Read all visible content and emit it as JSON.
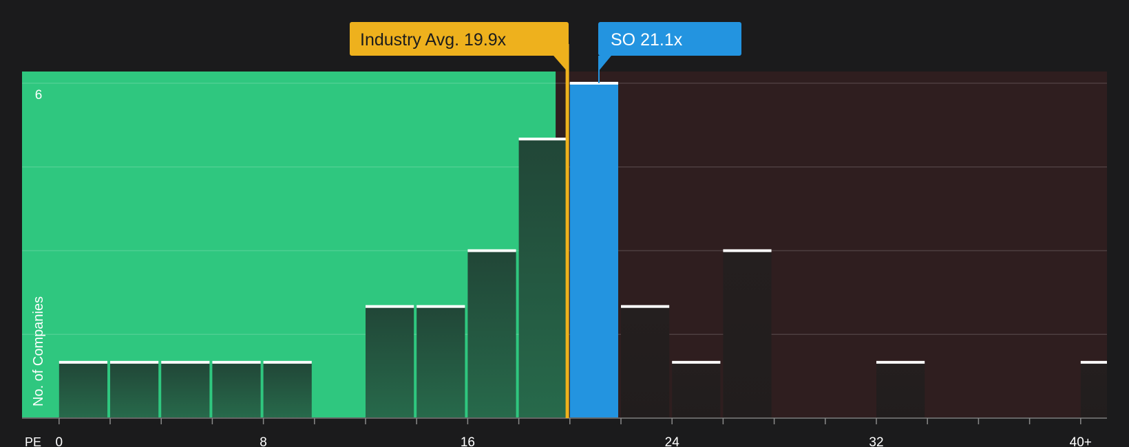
{
  "chart_data": {
    "type": "bar",
    "xlabel": "PE",
    "ylabel": "No. of Companies",
    "bin_width": 2,
    "bins": [
      {
        "x": 0,
        "count": 1
      },
      {
        "x": 2,
        "count": 1
      },
      {
        "x": 4,
        "count": 1
      },
      {
        "x": 6,
        "count": 1
      },
      {
        "x": 8,
        "count": 1
      },
      {
        "x": 10,
        "count": 0
      },
      {
        "x": 12,
        "count": 2
      },
      {
        "x": 14,
        "count": 2
      },
      {
        "x": 16,
        "count": 3
      },
      {
        "x": 18,
        "count": 5
      },
      {
        "x": 20,
        "count": 6
      },
      {
        "x": 22,
        "count": 2
      },
      {
        "x": 24,
        "count": 1
      },
      {
        "x": 26,
        "count": 3
      },
      {
        "x": 28,
        "count": 0
      },
      {
        "x": 30,
        "count": 0
      },
      {
        "x": 32,
        "count": 1
      },
      {
        "x": 34,
        "count": 0
      },
      {
        "x": 36,
        "count": 0
      },
      {
        "x": 38,
        "count": 0
      },
      {
        "x": 40,
        "count": 1
      }
    ],
    "highlight_bin_x": 20,
    "x_ticks": [
      {
        "value": 0,
        "label": "0"
      },
      {
        "value": 8,
        "label": "8"
      },
      {
        "value": 16,
        "label": "16"
      },
      {
        "value": 24,
        "label": "24"
      },
      {
        "value": 32,
        "label": "32"
      },
      {
        "value": 40,
        "label": "40+"
      }
    ],
    "y_max_label": "6",
    "ylim": [
      0,
      6
    ],
    "xlim": [
      -1.45,
      41
    ],
    "fair_value_boundary_x": 19.5,
    "grid": true,
    "markers": [
      {
        "name": "industry",
        "label": "Industry Avg. 19.9x",
        "value": 19.9,
        "color": "#eeb11d"
      },
      {
        "name": "company",
        "label": "SO 21.1x",
        "value": 21.1,
        "color": "#2394e0"
      }
    ],
    "colors": {
      "background": "#1b1b1c",
      "good_region": "#2fc77f",
      "bad_region": "#2f1e1f",
      "bar": "#23493a",
      "highlight_bar": "#2394e0",
      "bar_cap": "#ffffff"
    }
  }
}
